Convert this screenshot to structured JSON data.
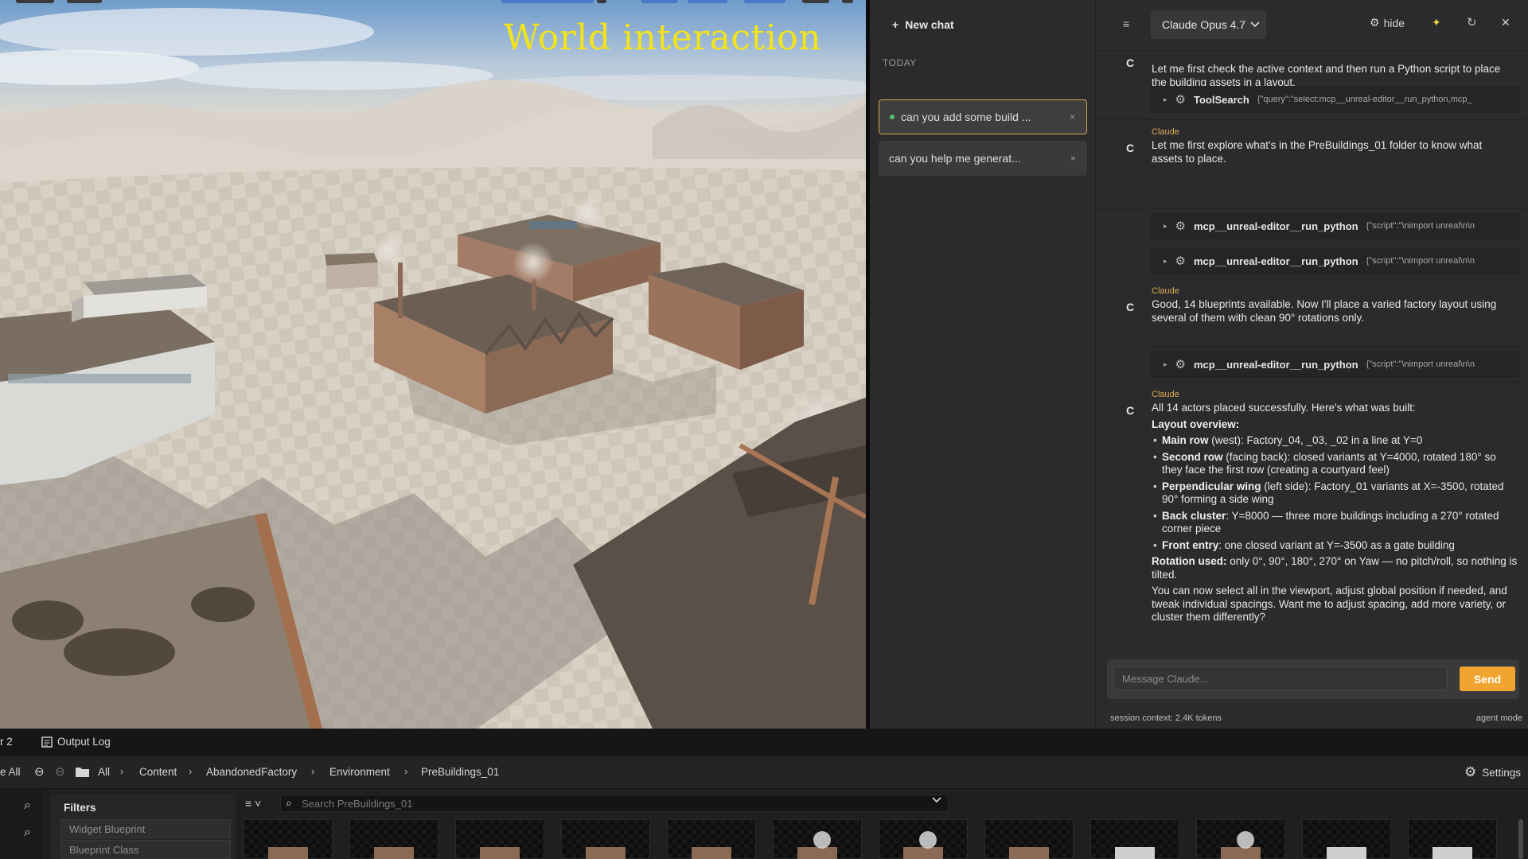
{
  "viewport": {
    "overlay_title": "World interaction"
  },
  "sidebar": {
    "new_chat_label": "New chat",
    "section_label": "TODAY",
    "chats": [
      {
        "title": "can you add some build ...",
        "active": true
      },
      {
        "title": "can you help me generat...",
        "active": false
      }
    ],
    "close_glyph": "×"
  },
  "chat_header": {
    "model": "Claude Opus 4.7",
    "hide_label": "hide",
    "icons": [
      "menu-icon",
      "gear-icon",
      "sparkle-icon",
      "refresh-icon",
      "close-icon"
    ]
  },
  "messages": {
    "m0_text": "Let me first check the active context and then run a Python script to place the building assets in a layout.",
    "tool1": {
      "name": "ToolSearch",
      "args": "{\"query\":\"select:mcp__unreal-editor__run_python,mcp_"
    },
    "m1": {
      "author": "Claude",
      "text": "Let me first explore what's in the PreBuildings_01 folder to know what assets to place."
    },
    "tool2": {
      "name": "mcp__unreal-editor__run_python",
      "args": "{\"script\":\"\\nimport unreal\\n\\n"
    },
    "tool3": {
      "name": "mcp__unreal-editor__run_python",
      "args": "{\"script\":\"\\nimport unreal\\n\\n"
    },
    "m2": {
      "author": "Claude",
      "text": "Good, 14 blueprints available. Now I'll place a varied factory layout using several of them with clean 90° rotations only."
    },
    "tool4": {
      "name": "mcp__unreal-editor__run_python",
      "args": "{\"script\":\"\\nimport unreal\\n\\n"
    },
    "m3": {
      "author": "Claude",
      "intro": "All 14 actors placed successfully. Here's what was built:",
      "layout_heading": "Layout overview:",
      "bullets": [
        {
          "bold": "Main row",
          "rest": " (west): Factory_04, _03, _02 in a line at Y=0"
        },
        {
          "bold": "Second row",
          "rest": " (facing back): closed variants at Y=4000, rotated 180° so they face the first row (creating a courtyard feel)"
        },
        {
          "bold": "Perpendicular wing",
          "rest": " (left side): Factory_01 variants at X=-3500, rotated 90° forming a side wing"
        },
        {
          "bold": "Back cluster",
          "rest": ": Y=8000 — three more buildings including a 270° rotated corner piece"
        },
        {
          "bold": "Front entry",
          "rest": ": one closed variant at Y=-3500 as a gate building"
        }
      ],
      "rotation_bold": "Rotation used:",
      "rotation_rest": " only 0°, 90°, 180°, 270° on Yaw — no pitch/roll, so nothing is tilted.",
      "outro": "You can now select all in the viewport, adjust global position if needed, and tweak individual spacings. Want me to adjust spacing, add more variety, or cluster them differently?"
    },
    "avatar_letter": "C"
  },
  "composer": {
    "placeholder": "Message Claude...",
    "send_label": "Send",
    "status_left": "session context: 2.4K tokens",
    "status_right": "agent mode"
  },
  "content_browser": {
    "tabs": [
      {
        "label": "r 2"
      },
      {
        "label": "Output Log"
      }
    ],
    "breadcrumbs": [
      "e All",
      "All",
      "Content",
      "AbandonedFactory",
      "Environment",
      "PreBuildings_01"
    ],
    "settings_label": "Settings",
    "filters_title": "Filters",
    "filters": [
      "Widget Blueprint",
      "Blueprint Class"
    ],
    "search_placeholder": "Search PreBuildings_01",
    "thumbnail_count": 12
  },
  "colors": {
    "accent": "#f1a530",
    "active_border": "#d6a64a",
    "author": "#d9a953",
    "overlay_title": "#f2e41a"
  }
}
